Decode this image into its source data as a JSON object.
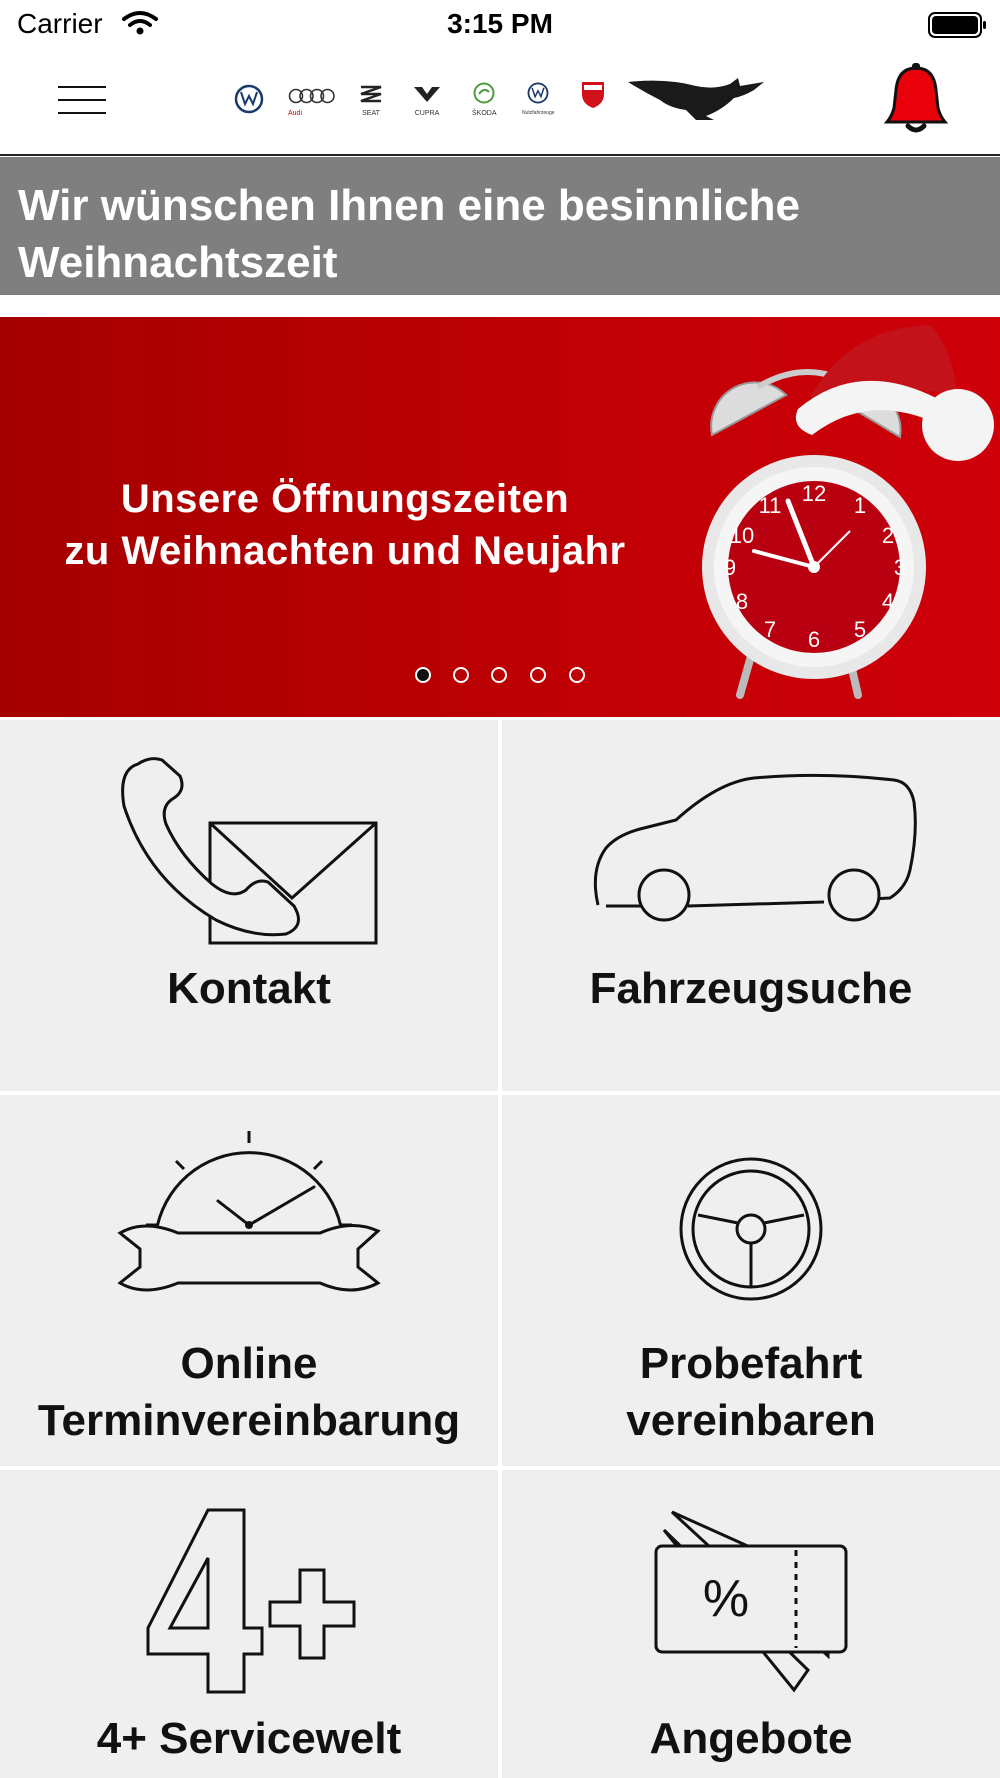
{
  "status_bar": {
    "carrier": "Carrier",
    "time": "3:15 PM"
  },
  "header": {
    "brands": [
      {
        "name": "vw-logo",
        "label": ""
      },
      {
        "name": "audi-logo",
        "label": "Audi"
      },
      {
        "name": "seat-logo",
        "label": "SEAT"
      },
      {
        "name": "cupra-logo",
        "label": "CUPRA"
      },
      {
        "name": "skoda-logo",
        "label": "ŠKODA"
      },
      {
        "name": "vw-nutzfahrzeuge-logo",
        "label": "Nutzfahrzeuge"
      },
      {
        "name": "ducati-logo",
        "label": "DUCATI"
      },
      {
        "name": "dealer-wolf-logo",
        "label": ""
      }
    ],
    "bell_color": "#e8000b"
  },
  "banner": {
    "title": "Wir wünschen Ihnen eine besinnliche Weihnachtszeit"
  },
  "hero": {
    "line1": "Unsere Öffnungszeiten",
    "line2": "zu Weihnachten und Neujahr",
    "slides_total": 5,
    "active_slide": 1
  },
  "tiles": [
    {
      "id": "kontakt",
      "label": "Kontakt",
      "icon": "phone-mail-icon"
    },
    {
      "id": "fahrzeugsuche",
      "label": "Fahrzeugsuche",
      "icon": "car-icon"
    },
    {
      "id": "termin",
      "label1": "Online",
      "label2": "Terminvereinbarung",
      "icon": "clock-wrench-icon"
    },
    {
      "id": "probefahrt",
      "label1": "Probefahrt",
      "label2": "vereinbaren",
      "icon": "steering-wheel-icon"
    },
    {
      "id": "service",
      "label": "4+ Servicewelt",
      "icon": "four-plus-icon"
    },
    {
      "id": "angebote",
      "label": "Angebote",
      "icon": "coupon-icon"
    }
  ],
  "colors": {
    "accent_red": "#c00004",
    "banner_gray": "#7f7f7f",
    "tile_bg": "#efefef"
  }
}
